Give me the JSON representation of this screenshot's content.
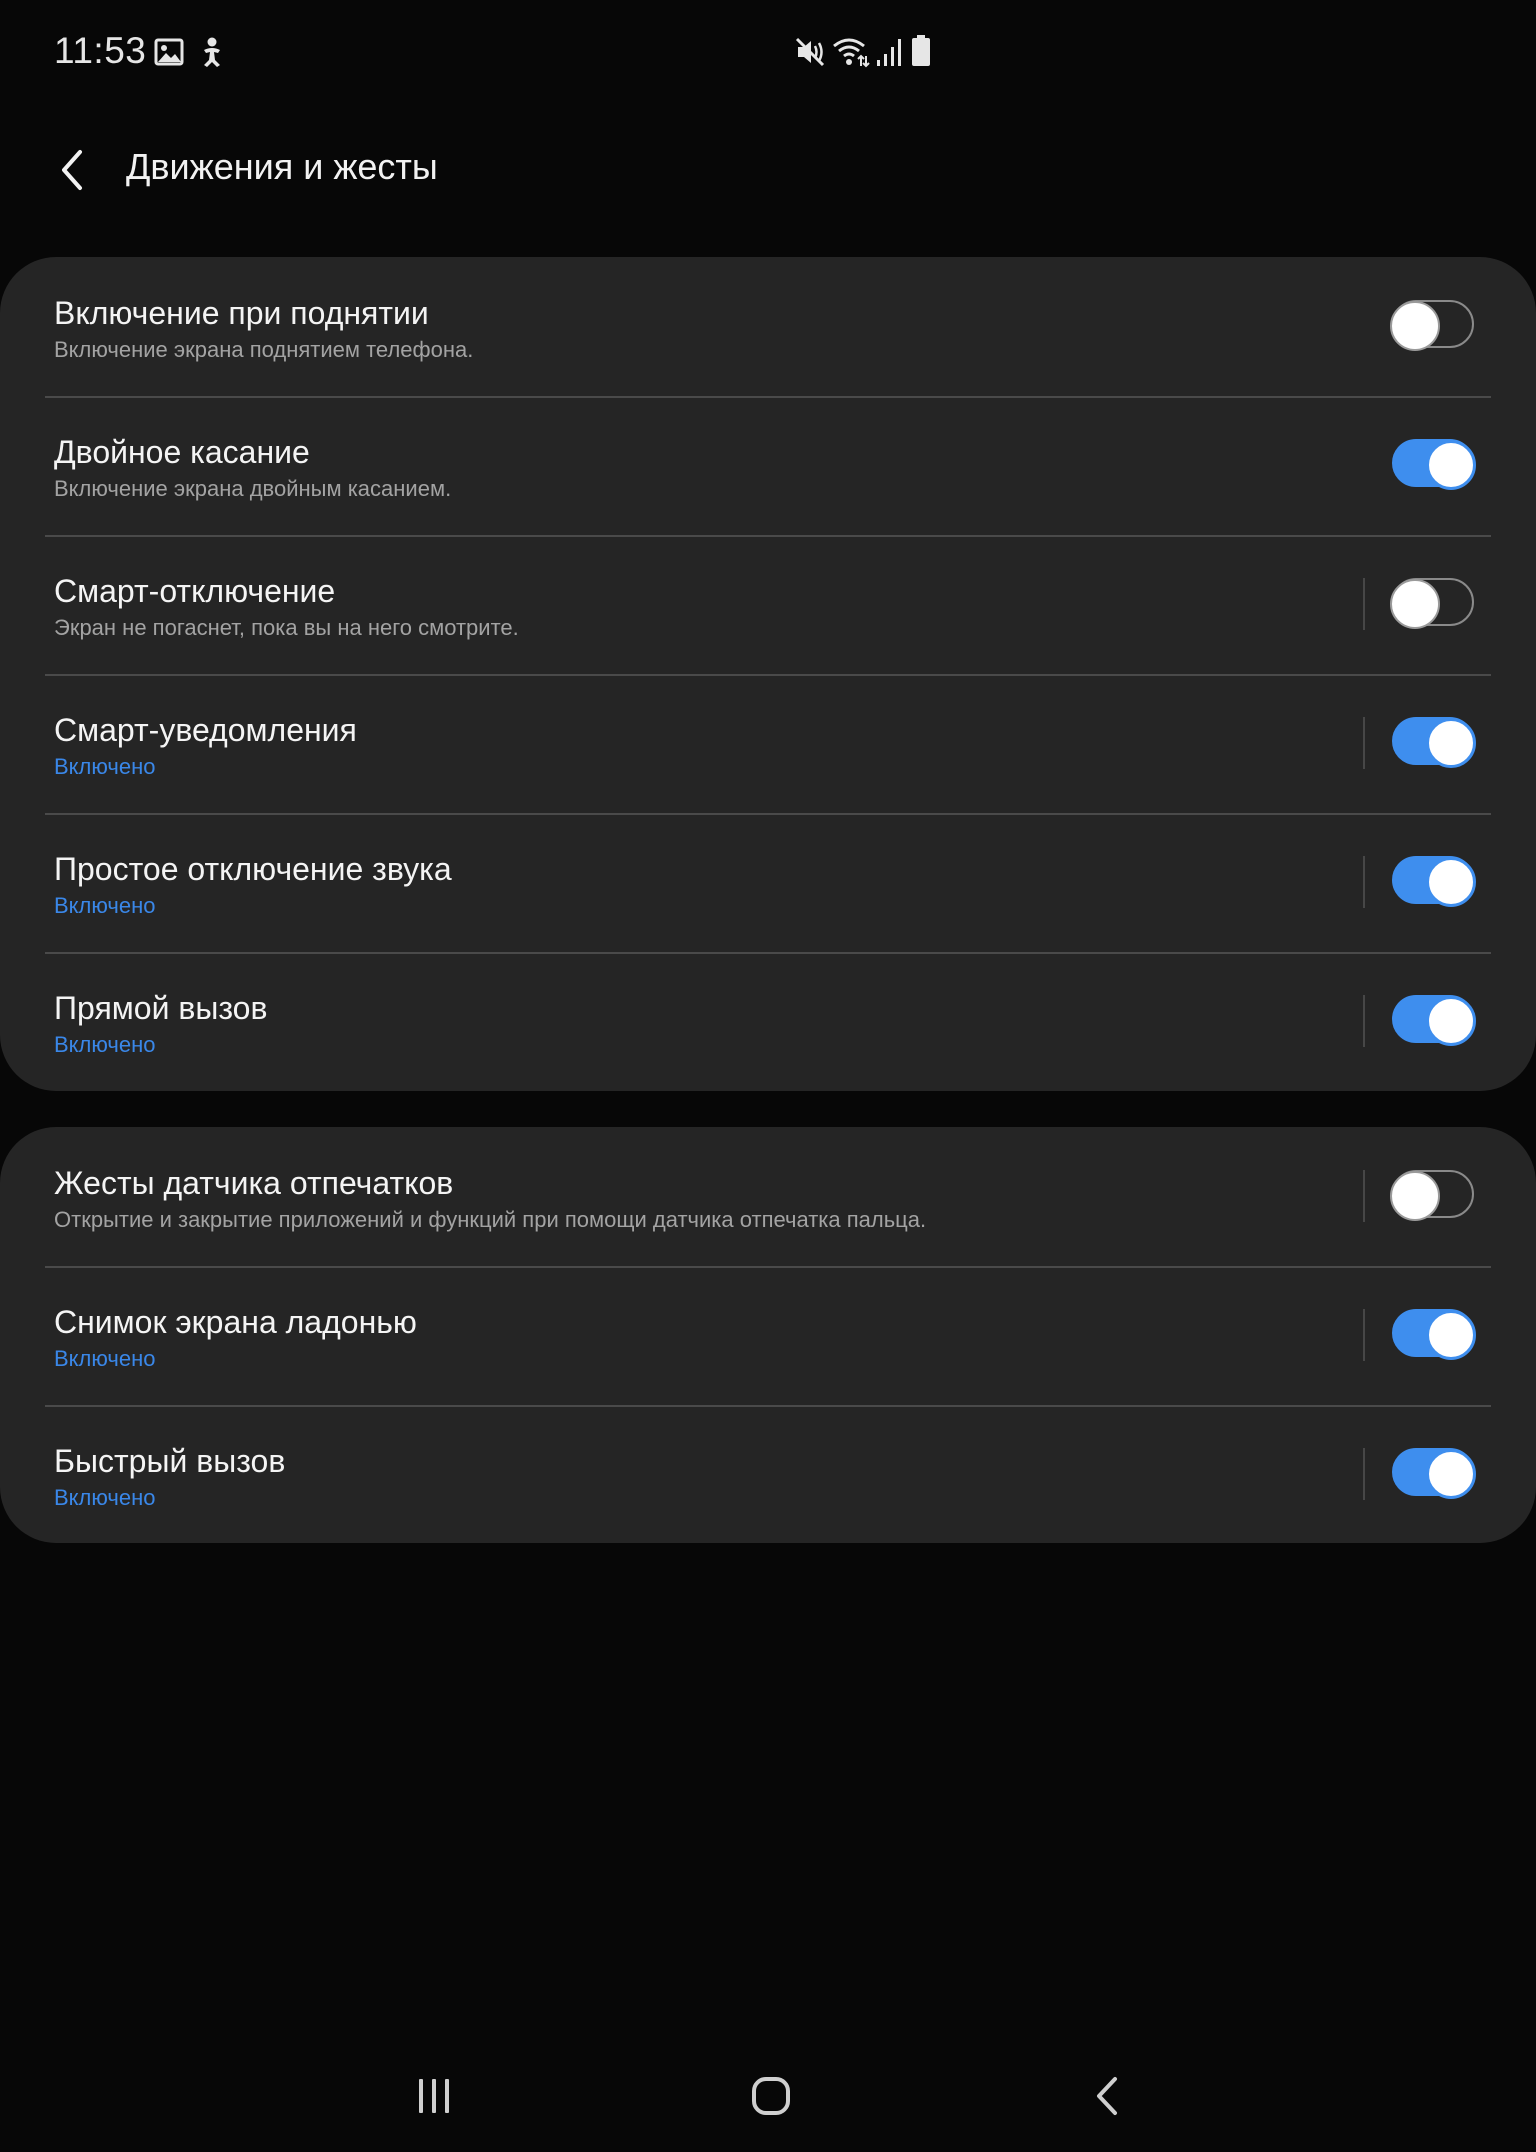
{
  "status_bar": {
    "time": "11:53",
    "left_icons": [
      "gallery-icon",
      "accessibility-icon"
    ],
    "right_icons": [
      "vibrate-mute-icon",
      "wifi-icon",
      "signal-icon",
      "battery-icon"
    ]
  },
  "header": {
    "title": "Движения и жесты",
    "back_icon": "chevron-left-icon"
  },
  "accent_color": "#3e8eee",
  "groups": [
    {
      "items": [
        {
          "title": "Включение при поднятии",
          "subtitle": "Включение экрана поднятием телефона.",
          "enabled": false
        },
        {
          "title": "Двойное касание",
          "subtitle": "Включение экрана двойным касанием.",
          "enabled": true
        },
        {
          "title": "Смарт-отключение",
          "subtitle": "Экран не погаснет, пока вы на него смотрите.",
          "enabled": false
        },
        {
          "title": "Смарт-уведомления",
          "subtitle": "Включено",
          "enabled": true
        },
        {
          "title": "Простое отключение звука",
          "subtitle": "Включено",
          "enabled": true
        },
        {
          "title": "Прямой вызов",
          "subtitle": "Включено",
          "enabled": true
        }
      ]
    },
    {
      "items": [
        {
          "title": "Жесты датчика отпечатков",
          "subtitle": "Открытие и закрытие приложений и функций при помощи датчика отпечатка пальца.",
          "enabled": false
        },
        {
          "title": "Снимок экрана ладонью",
          "subtitle": "Включено",
          "enabled": true
        },
        {
          "title": "Быстрый вызов",
          "subtitle": "Включено",
          "enabled": true
        }
      ]
    }
  ],
  "nav_bar": {
    "buttons": [
      "recents-icon",
      "home-icon",
      "back-icon"
    ]
  }
}
